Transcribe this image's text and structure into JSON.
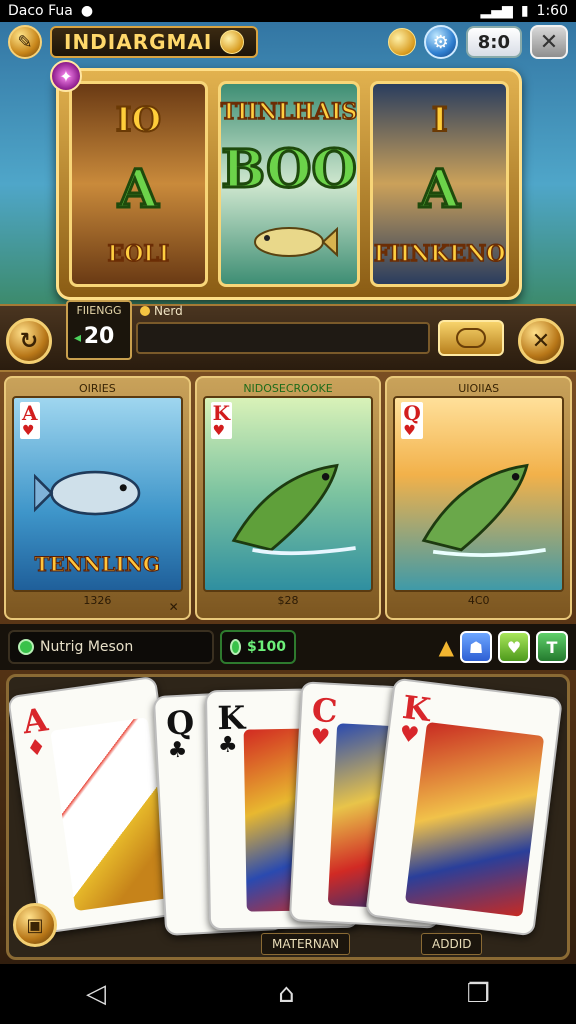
{
  "status": {
    "left_text": "Daco Fua",
    "time": "1:60"
  },
  "topbar": {
    "title": "INDIARGMAI",
    "counter": "8:0"
  },
  "reels": [
    {
      "top": "IO",
      "middle": "A",
      "bottom": "EOLI"
    },
    {
      "top": "TIINLHAIS",
      "middle": "BOO",
      "bottom": ""
    },
    {
      "top": "I",
      "middle": "A",
      "bottom": "FIINKENO"
    }
  ],
  "bet": {
    "label": "FIIENGG",
    "value": "20",
    "bar_label": "Nerd"
  },
  "panels": [
    {
      "title": "OIRIES",
      "rank": "A",
      "suit": "♥",
      "caption": "TENNLING",
      "price": "1326"
    },
    {
      "title": "NIDOSECROOKE",
      "rank": "K",
      "suit": "♥",
      "caption": "",
      "price": "$28"
    },
    {
      "title": "UIOIIAS",
      "rank": "Q",
      "suit": "♥",
      "caption": "",
      "price": "4C0"
    }
  ],
  "info": {
    "name": "Nutrig Meson",
    "amount": "$100",
    "btn_t": "T"
  },
  "hand": {
    "cards": [
      {
        "rank": "A",
        "suit": "♦",
        "color": "red"
      },
      {
        "rank": "Q",
        "suit": "♣",
        "color": "black"
      },
      {
        "rank": "K",
        "suit": "♣",
        "color": "black"
      },
      {
        "rank": "C",
        "suit": "♥",
        "color": "red"
      },
      {
        "rank": "K",
        "suit": "♥",
        "color": "red"
      }
    ],
    "tag_left": "MATERNAN",
    "tag_right": "ADDID"
  },
  "icons": [
    "fish-icon",
    "coin-icon",
    "gear-icon",
    "close-icon",
    "gem-icon",
    "spin-icon",
    "bell-icon",
    "back-icon",
    "home-icon",
    "recents-icon"
  ],
  "colors": {
    "gold": "#e2b24f",
    "dark": "#2e2519",
    "accent_green": "#39c24a"
  }
}
